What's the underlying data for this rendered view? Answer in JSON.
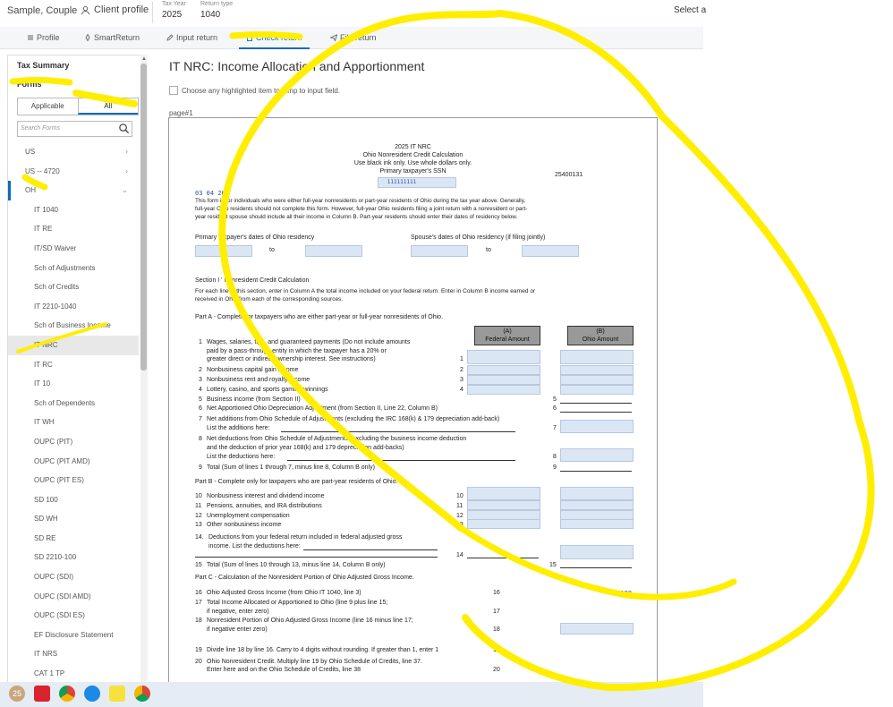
{
  "topbar": {
    "client_name": "Sample, Couple",
    "client_profile": "Client profile",
    "tax_year_label": "Tax Year",
    "tax_year": "2025",
    "return_type_label": "Return type",
    "return_type": "1040",
    "select_text": "Select a"
  },
  "nav": {
    "tabs": [
      {
        "label": "Profile",
        "active": false
      },
      {
        "label": "SmartReturn",
        "active": false
      },
      {
        "label": "Input return",
        "active": false
      },
      {
        "label": "Check return",
        "active": true
      },
      {
        "label": "File return",
        "active": false
      }
    ]
  },
  "sidebar": {
    "title": "Tax Summary",
    "forms_label": "Forms",
    "filter_applicable": "Applicable",
    "filter_all": "All",
    "search_placeholder": "Search Forms",
    "items": [
      {
        "label": "US",
        "level": 0,
        "chevron": "›"
      },
      {
        "label": "US -- 4720",
        "level": 0,
        "chevron": "›"
      },
      {
        "label": "OH",
        "level": 0,
        "chevron": "⌄"
      },
      {
        "label": "IT 1040",
        "level": 1
      },
      {
        "label": "IT RE",
        "level": 1
      },
      {
        "label": "IT/SD Waiver",
        "level": 1
      },
      {
        "label": "Sch of Adjustments",
        "level": 1
      },
      {
        "label": "Sch of Credits",
        "level": 1
      },
      {
        "label": "IT 2210-1040",
        "level": 1
      },
      {
        "label": "Sch of Business Income",
        "level": 1
      },
      {
        "label": "IT NRC",
        "level": 1,
        "selected": true
      },
      {
        "label": "IT RC",
        "level": 1
      },
      {
        "label": "IT 10",
        "level": 1
      },
      {
        "label": "Sch of Dependents",
        "level": 1
      },
      {
        "label": "IT WH",
        "level": 1
      },
      {
        "label": "OUPC (PIT)",
        "level": 1
      },
      {
        "label": "OUPC (PIT AMD)",
        "level": 1
      },
      {
        "label": "OUPC (PIT ES)",
        "level": 1
      },
      {
        "label": "SD 100",
        "level": 1
      },
      {
        "label": "SD WH",
        "level": 1
      },
      {
        "label": "SD RE",
        "level": 1
      },
      {
        "label": "SD 2210-100",
        "level": 1
      },
      {
        "label": "OUPC (SDI)",
        "level": 1
      },
      {
        "label": "OUPC (SDI AMD)",
        "level": 1
      },
      {
        "label": "OUPC (SDI ES)",
        "level": 1
      },
      {
        "label": "EF Disclosure Statement",
        "level": 1
      },
      {
        "label": "IT NRS",
        "level": 1
      },
      {
        "label": "CAT 1 TP",
        "level": 1
      }
    ]
  },
  "main": {
    "title": "IT NRC: Income Allocation and Apportionment",
    "choose_text": "Choose any highlighted item to jump to input field.",
    "page_label": "page#1"
  },
  "form": {
    "year_title": "2025 IT NRC",
    "subtitle": "Ohio Nonresident Credit Calculation",
    "instructions": "Use black ink only. Use whole dollars only.",
    "ssn_label": "Primary taxpayer's SSN",
    "ssn_value": "111111111",
    "form_code": "25400131",
    "date_code": "03  04  26",
    "intro_1": "This form is for individuals who were either full-year nonresidents or part-year residents of Ohio during the tax year above. Generally,",
    "intro_2": "full-year Ohio residents should not complete this form. However, full-year Ohio residents filing a joint return with a nonresident or part-",
    "intro_3": "year resident spouse should include all their income in Column B. Part-year residents should enter their dates of residency below.",
    "primary_dates_label": "Primary taxpayer's dates of Ohio residency",
    "spouse_dates_label": "Spouse's dates of Ohio residency (if filing jointly)",
    "to": "to",
    "section1_title": "Section I ' Nonresident Credit Calculation",
    "section1_text_1": "For each line in this section, enter in Column A the total income included on your federal return. Enter in Column B income earned or",
    "section1_text_2": "received in Ohio from each of the corresponding sources.",
    "partA_title": "Part A - Complete for taxpayers who are either part-year or full-year nonresidents of Ohio.",
    "colA_1": "(A)",
    "colA_2": "Federal Amount",
    "colB_1": "(B)",
    "colB_2": "Ohio Amount",
    "lines": {
      "l1a": "Wages, salaries, tips, and guaranteed payments (Do not include amounts",
      "l1b": "paid by a pass-through entity in which the taxpayer has a 20% or",
      "l1c": "greater direct or indirect ownership interest. See instructions)",
      "l2": "Nonbusiness capital gain income",
      "l3": "Nonbusiness rent and royalty income",
      "l4": "Lottery, casino, and sports gaming winnings",
      "l5": "Business income (from Section II)",
      "l6": "Net Apportioned Ohio Depreciation Adjustment (from Section II, Line 22, Column B)",
      "l7a": "Net additions from Ohio Schedule of Adjustments (excluding the IRC 168(k) & 179 depreciation add-back)",
      "l7b": "List the additions here:",
      "l8a": "Net deductions from Ohio Schedule of Adjustments (excluding the business income deduction",
      "l8b": "and the deduction of prior year 168(k) and 179 depreciation add-backs)",
      "l8c": "List the deductions here:",
      "l9": "Total (Sum of lines 1 through 7, minus line 8, Column B only)",
      "partB_title": "Part B - Complete only for taxpayers who are part-year residents of Ohio.",
      "l10": "Nonbusiness interest and dividend income",
      "l11": "Pensions, annuities, and IRA distributions",
      "l12": "Unemployment compensation",
      "l13": "Other nonbusiness income",
      "l14a": "Deductions from your federal return included in federal adjusted gross",
      "l14b": "income. List the deductions here:",
      "l15": "Total (Sum of lines 10 through 13, minus line 14, Column B only)",
      "partC_title": "Part C - Calculation of the Nonresident Portion of Ohio Adjusted Gross Income.",
      "l16": "Ohio Adjusted Gross Income (from Ohio IT 1040, line 3)",
      "l16_value": "66128",
      "l17a": "Total Income Allocated or Apportioned to Ohio (line 9 plus line 15;",
      "l17b": "if negative, enter zero)",
      "l18a": "Nonresident Portion of Ohio Adjusted Gross Income (line 16 minus line 17;",
      "l18b": "if negative enter zero)",
      "l19": "Divide line 18 by line 16. Carry to 4 digits without rounding. If greater than 1, enter 1",
      "l20a": "Ohio Nonresident Credit. Multiply line 19 by Ohio Schedule of Credits, line 37.",
      "l20b": "Enter here and on the Ohio Schedule of Credits, line 38"
    }
  },
  "taskbar": {
    "badge": "25"
  },
  "colors": {
    "accent": "#0b6cbd",
    "highlight": "#ffee00",
    "field_fill": "#dbe6f4"
  }
}
